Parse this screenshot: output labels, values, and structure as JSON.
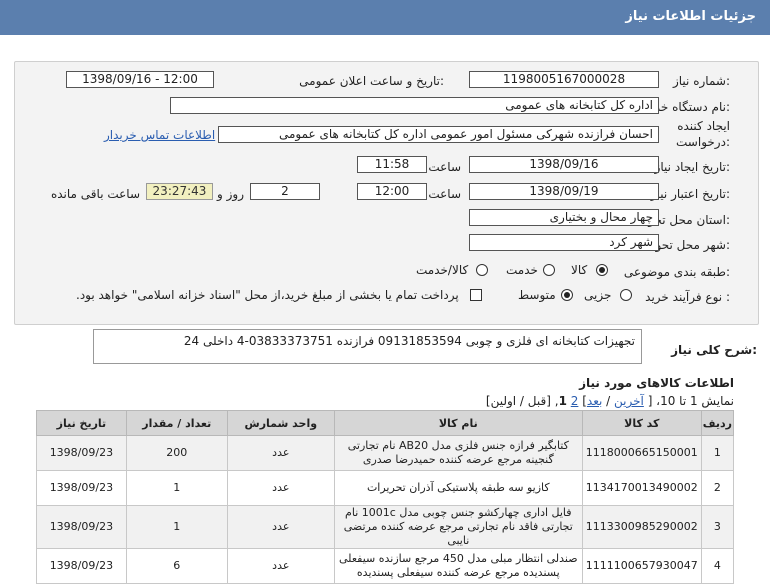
{
  "header": {
    "title": "جزئیات اطلاعات نیاز"
  },
  "form": {
    "need_number_label": "شماره نیاز:",
    "need_number": "1198005167000028",
    "announce_label": "تاریخ و ساعت اعلان عمومی:",
    "announce_value": "1398/09/16 - 12:00",
    "buyer_label": "نام دستگاه خریدار:",
    "buyer_value": "اداره کل کتابخانه های عمومی",
    "creator_label_1": "ایجاد کننده",
    "creator_label_2": "درخواست:",
    "creator_value": "احسان فرازنده شهرکی مسئول امور عمومی اداره کل کتابخانه های عمومی",
    "contact_link": "اطلاعات تماس خریدار",
    "created_label": "تاریخ ایجاد نیاز:",
    "created_date": "1398/09/16",
    "time_label": "ساعت",
    "created_time": "11:58",
    "validity_label": "تاریخ اعتبار نیاز:",
    "validity_date": "1398/09/19",
    "validity_time": "12:00",
    "day_label": "روز و",
    "days": "2",
    "remaining_time": "23:27:43",
    "remaining_label": "ساعت باقی مانده",
    "province_label": "استان محل تحویل:",
    "province_value": "چهار محال و بختیاری",
    "city_label": "شهر محل تحویل:",
    "city_value": "شهر کرد",
    "category_label": "طبقه بندی موضوعی:",
    "category_options": [
      "کالا",
      "خدمت",
      "کالا/خدمت"
    ],
    "category_selected": "کالا",
    "process_label": "نوع فرآیند خرید :",
    "process_options": [
      "جزیی",
      "متوسط"
    ],
    "process_selected": "متوسط",
    "payment_note": "پرداخت تمام یا بخشی از مبلغ خرید،از محل \"اسناد خزانه اسلامی\" خواهد بود."
  },
  "description": {
    "label": "شرح کلی نیاز:",
    "text": "تجهیزات کتابخانه ای فلزی و چوبی 09131853594 فرازنده 03833373751-4 داخلی 24"
  },
  "items_section": {
    "title": "اطلاعات کالاهای مورد نیاز",
    "pager_prefix": "نمایش 1 تا 10، [",
    "pager_last": "آخرین",
    "pager_next": "بعد",
    "pager_p2": "2",
    "pager_p1": "1",
    "pager_suffix": "[قبل / اولین]",
    "columns": [
      "ردیف",
      "کد کالا",
      "نام کالا",
      "واحد شمارش",
      "تعداد / مقدار",
      "تاریخ نیاز"
    ],
    "rows": [
      {
        "row": "1",
        "code": "1118000665150001",
        "name": "کتابگیر فرازه جنس فلزی مدل AB20 نام تجارتی گنجینه مرجع عرضه کننده حمیدرضا صدری",
        "unit": "عدد",
        "qty": "200",
        "date": "1398/09/23"
      },
      {
        "row": "2",
        "code": "1134170013490002",
        "name": "کازیو سه طبقه پلاستیکی آذران تحریرات",
        "unit": "عدد",
        "qty": "1",
        "date": "1398/09/23"
      },
      {
        "row": "3",
        "code": "1113300985290002",
        "name": "فایل اداری چهارکشو جنس چوبی مدل 1001c نام تجارتی فاقد نام تجارتی مرجع عرضه کننده مرتضی نایبی",
        "unit": "عدد",
        "qty": "1",
        "date": "1398/09/23"
      },
      {
        "row": "4",
        "code": "1111100657930047",
        "name": "صندلی انتظار مبلی مدل 450 مرجع سازنده سیفعلی پسندیده مرجع عرضه کننده سیفعلی پسندیده",
        "unit": "عدد",
        "qty": "6",
        "date": "1398/09/23"
      }
    ]
  }
}
